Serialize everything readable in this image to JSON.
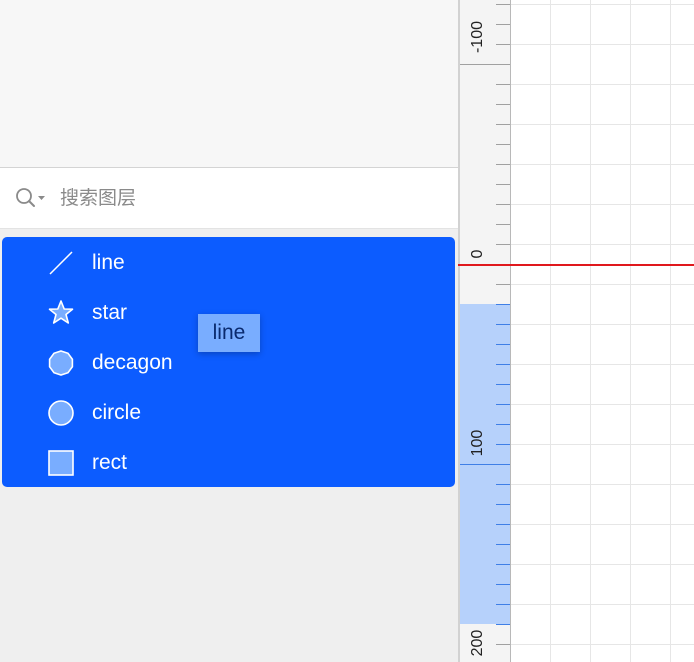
{
  "search": {
    "placeholder": "搜索图层",
    "icon": "search-icon"
  },
  "layers": {
    "selection_color": "#0c5cff",
    "items": [
      {
        "label": "line",
        "icon": "line-icon"
      },
      {
        "label": "star",
        "icon": "star-icon"
      },
      {
        "label": "decagon",
        "icon": "decagon-icon"
      },
      {
        "label": "circle",
        "icon": "circle-icon"
      },
      {
        "label": "rect",
        "icon": "rect-icon"
      }
    ]
  },
  "drag_tooltip": {
    "label": "line"
  },
  "ruler": {
    "labels": [
      "-100",
      "0",
      "100",
      "200"
    ],
    "origin_line_color": "#e0181d",
    "highlight_color": "#b6d1fb"
  }
}
